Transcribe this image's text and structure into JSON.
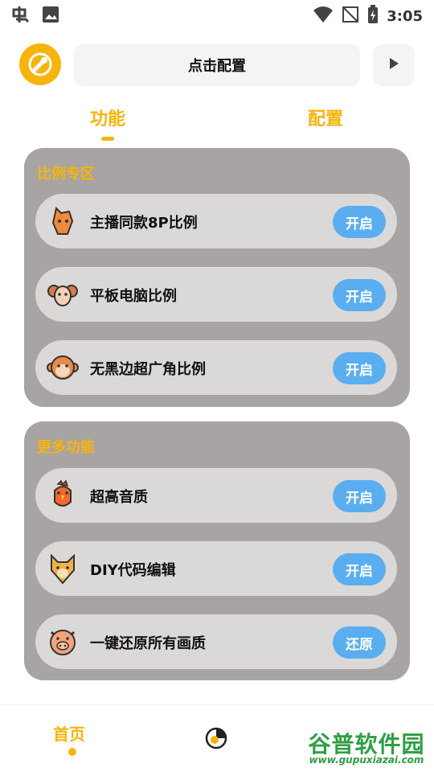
{
  "status_bar": {
    "time": "3:05",
    "left_icons": [
      "app-notification-icon",
      "image-icon"
    ],
    "right_icons": [
      "wifi-icon",
      "no-signal-icon",
      "battery-charging-icon"
    ]
  },
  "header": {
    "config_button_label": "点击配置",
    "logo_icon": "wrench-settings-icon",
    "play_icon": "play-icon"
  },
  "tabs": [
    {
      "label": "功能",
      "active": true
    },
    {
      "label": "配置",
      "active": false
    }
  ],
  "sections": [
    {
      "title": "比例专区",
      "items": [
        {
          "label": "主播同款8P比例",
          "icon": "horse-icon",
          "button": "开启"
        },
        {
          "label": "平板电脑比例",
          "icon": "ram-icon",
          "button": "开启"
        },
        {
          "label": "无黑边超广角比例",
          "icon": "monkey-icon",
          "button": "开启"
        }
      ]
    },
    {
      "title": "更多功能",
      "items": [
        {
          "label": "超高音质",
          "icon": "rooster-icon",
          "button": "开启"
        },
        {
          "label": "DIY代码编辑",
          "icon": "dog-icon",
          "button": "开启"
        },
        {
          "label": "一键还原所有画质",
          "icon": "pig-icon",
          "button": "还原"
        }
      ]
    }
  ],
  "bottom_nav": {
    "home_label": "首页",
    "stats_icon": "pie-chart-icon"
  },
  "watermark": {
    "title": "谷普软件园",
    "url": "www.gupuxiazai.com"
  },
  "colors": {
    "accent": "#f7b40c",
    "card_bg": "#a8a4a3",
    "item_bg": "#dad9d8",
    "button": "#5aaef0"
  }
}
